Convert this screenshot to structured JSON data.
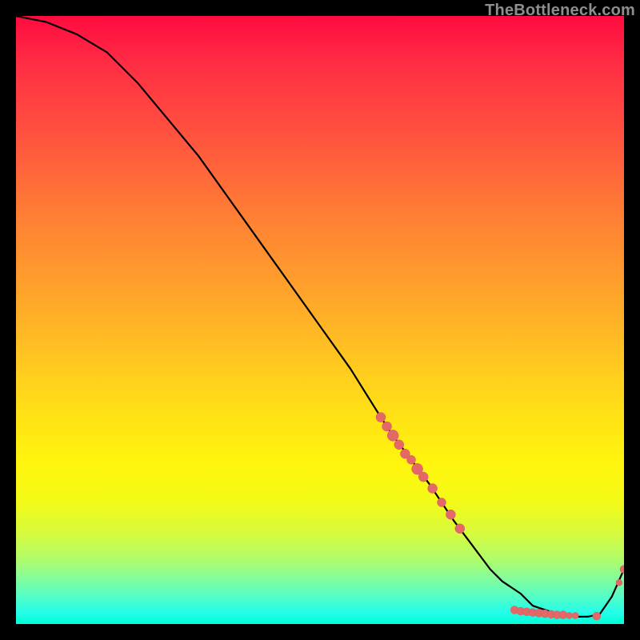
{
  "watermark": "TheBottleneck.com",
  "chart_data": {
    "type": "line",
    "title": "",
    "xlabel": "",
    "ylabel": "",
    "xlim": [
      0,
      100
    ],
    "ylim": [
      0,
      100
    ],
    "series": [
      {
        "name": "bottleneck-curve",
        "x": [
          0,
          5,
          10,
          15,
          20,
          25,
          30,
          35,
          40,
          45,
          50,
          55,
          60,
          62,
          65,
          68,
          72,
          75,
          78,
          80,
          83,
          85,
          88,
          90,
          92,
          94,
          96,
          98,
          100
        ],
        "y": [
          100,
          99,
          97,
          94,
          89,
          83,
          77,
          70,
          63,
          56,
          49,
          42,
          34,
          31,
          27,
          23,
          17,
          13,
          9,
          7,
          5,
          3,
          2,
          1.5,
          1.2,
          1.2,
          1.6,
          4.5,
          9
        ]
      }
    ],
    "markers": {
      "name": "highlighted-points",
      "color": "#e46868",
      "points": [
        {
          "x": 60,
          "y": 34,
          "r": 6
        },
        {
          "x": 61,
          "y": 32.5,
          "r": 6
        },
        {
          "x": 62,
          "y": 31,
          "r": 7
        },
        {
          "x": 63,
          "y": 29.5,
          "r": 6
        },
        {
          "x": 64,
          "y": 28,
          "r": 6
        },
        {
          "x": 65,
          "y": 27,
          "r": 5.5
        },
        {
          "x": 66,
          "y": 25.5,
          "r": 7
        },
        {
          "x": 67,
          "y": 24.2,
          "r": 6
        },
        {
          "x": 68.5,
          "y": 22.3,
          "r": 6
        },
        {
          "x": 70,
          "y": 20,
          "r": 5.5
        },
        {
          "x": 71.5,
          "y": 18,
          "r": 6
        },
        {
          "x": 73,
          "y": 15.7,
          "r": 6
        },
        {
          "x": 82,
          "y": 2.3,
          "r": 5
        },
        {
          "x": 83,
          "y": 2.1,
          "r": 5
        },
        {
          "x": 84,
          "y": 2.0,
          "r": 5
        },
        {
          "x": 85,
          "y": 1.9,
          "r": 5
        },
        {
          "x": 86,
          "y": 1.8,
          "r": 5
        },
        {
          "x": 87,
          "y": 1.7,
          "r": 5
        },
        {
          "x": 88,
          "y": 1.6,
          "r": 5
        },
        {
          "x": 89,
          "y": 1.5,
          "r": 5
        },
        {
          "x": 90,
          "y": 1.5,
          "r": 5
        },
        {
          "x": 91,
          "y": 1.4,
          "r": 4
        },
        {
          "x": 92,
          "y": 1.4,
          "r": 4
        },
        {
          "x": 95.5,
          "y": 1.3,
          "r": 5
        },
        {
          "x": 100,
          "y": 9,
          "r": 5
        },
        {
          "x": 99.2,
          "y": 6.8,
          "r": 4
        }
      ]
    }
  }
}
